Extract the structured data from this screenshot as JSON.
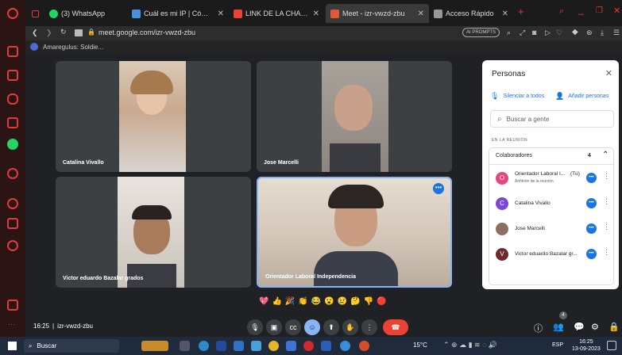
{
  "tabs": [
    {
      "label": "(3) WhatsApp",
      "color": "#25d366"
    },
    {
      "label": "Cuál es mi IP | Cómo saber",
      "color": "#4a90e2"
    },
    {
      "label": "LINK DE LA CHARLA. - orie",
      "color": "#ea4335"
    },
    {
      "label": "Meet - izr-vwzd-zbu",
      "color": "#e05a3a"
    },
    {
      "label": "Acceso Rápido",
      "color": "#aaa"
    }
  ],
  "address": {
    "url": "meet.google.com/izr-vwzd-zbu",
    "badge": "AI PROMPTS"
  },
  "bookmark": "Amaregulus: Soldie...",
  "participants_tiles": [
    {
      "name": "Catalina Vivallo"
    },
    {
      "name": "Jose Marcelli"
    },
    {
      "name": "Victor eduardo Bazalar grados"
    },
    {
      "name": "Orientador Laboral Independencia"
    }
  ],
  "panel": {
    "title": "Personas",
    "mute_all": "Silenciar a todos",
    "add_people": "Añadir personas",
    "search_placeholder": "Buscar a gente",
    "section": "EN LA REUNIÓN",
    "group_label": "Colaboradores",
    "group_count": "4",
    "people": [
      {
        "initial": "O",
        "name": "Orientador Laboral I...",
        "tag": "(Tú)",
        "sub": "Anfitrión de la reunión",
        "color": "#e8457e"
      },
      {
        "initial": "C",
        "name": "Catalina Vivallo",
        "tag": "",
        "sub": "",
        "color": "#7b47d6"
      },
      {
        "initial": "J",
        "name": "Jose Marcelli",
        "tag": "",
        "sub": "",
        "color": "#8d6e63"
      },
      {
        "initial": "V",
        "name": "Victor eduardo Bazalar gr...",
        "tag": "",
        "sub": "",
        "color": "#6d2c2c"
      }
    ]
  },
  "meeting": {
    "time": "16:25",
    "separator": "|",
    "code": "izr-vwzd-zbu",
    "people_badge": "4"
  },
  "reactions": [
    "💖",
    "👍",
    "🎉",
    "👏",
    "😂",
    "😮",
    "😢",
    "🤔",
    "👎",
    "🔴"
  ],
  "taskbar": {
    "search": "Buscar",
    "temp": "15°C",
    "lang": "ESP",
    "time": "16:25",
    "date": "13-09-2023"
  }
}
